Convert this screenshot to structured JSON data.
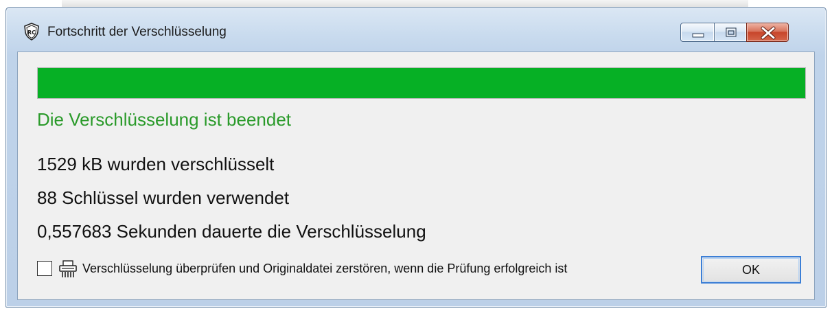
{
  "window": {
    "title": "Fortschritt der Verschlüsselung",
    "icon": "shield-icon",
    "controls": [
      "minimize-icon",
      "maximize-icon",
      "close-icon"
    ]
  },
  "progress": {
    "value": 1.0,
    "color": "#06b025"
  },
  "status": {
    "text": "Die Verschlüsselung ist beendet",
    "color": "#2a9a2a"
  },
  "stats": {
    "size_line": "1529 kB wurden verschlüsselt",
    "keys_line": "88 Schlüssel wurden verwendet",
    "time_line": "0,557683 Sekunden dauerte die Verschlüsselung"
  },
  "verify": {
    "checked": false,
    "icon": "shredder-icon",
    "label": "Verschlüsselung überprüfen und Originaldatei zerstören, wenn die Prüfung erfolgreich ist"
  },
  "buttons": {
    "ok_label": "OK"
  }
}
